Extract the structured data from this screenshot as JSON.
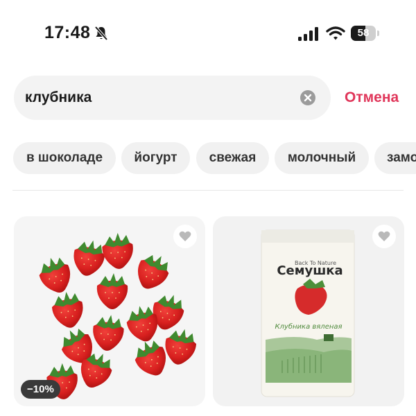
{
  "status_bar": {
    "time": "17:48",
    "battery_level": "58",
    "battery_fraction": 0.58,
    "icons": [
      "bell-muted-icon",
      "signal-icon",
      "wifi-icon",
      "battery-icon"
    ]
  },
  "search": {
    "value": "клубника",
    "cancel_label": "Отмена"
  },
  "chips": [
    "в шоколаде",
    "йогурт",
    "свежая",
    "молочный",
    "замо"
  ],
  "products": [
    {
      "badge": "−10%",
      "image": "fresh-strawberries"
    },
    {
      "brand_tagline": "Back To Nature",
      "brand": "Семушка",
      "product_name": "Клубника вяленая",
      "image": "dried-strawberry-pack"
    }
  ],
  "colors": {
    "accent": "#e0365a",
    "chip_bg": "#f1f1f1",
    "search_bg": "#f3f3f3",
    "card_bg": "#f5f5f5"
  }
}
